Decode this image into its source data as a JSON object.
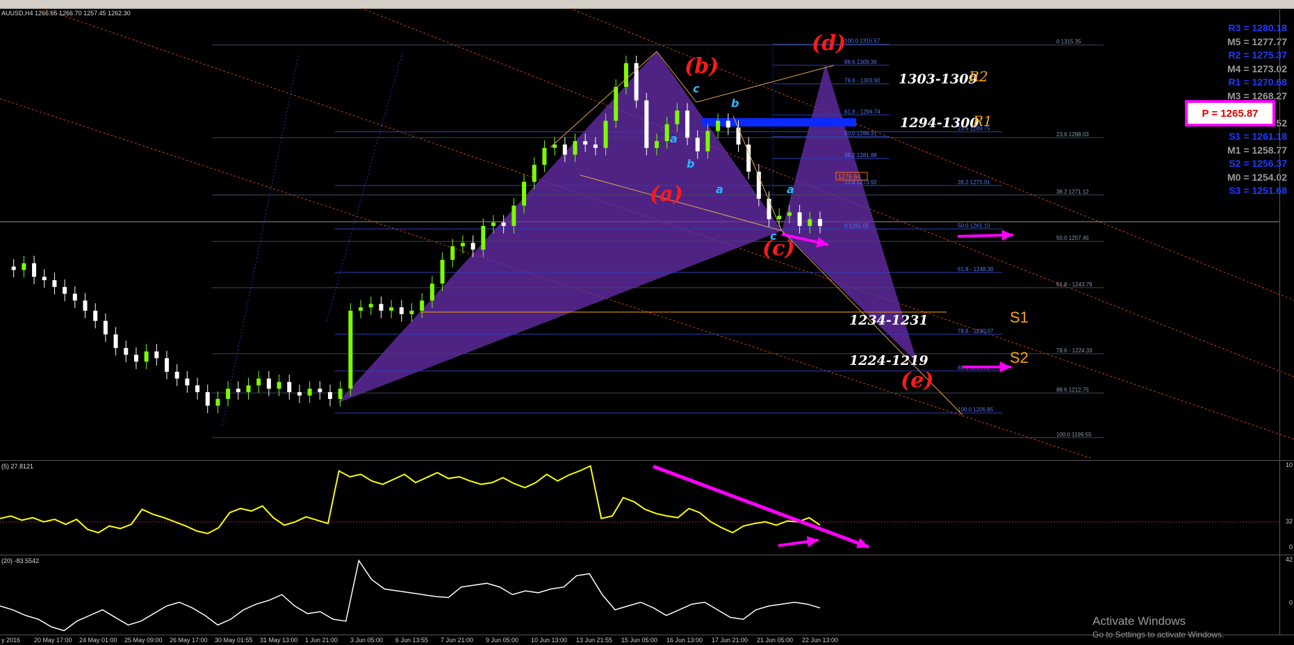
{
  "symbol_info": "AUUSD,H4  1266.65 1266.70 1257.45 1262.30",
  "rsi_info": "(5) 27.8121",
  "cci_info": "(20) -83.5542",
  "chart_data": {
    "type": "candlestick",
    "title": "AUUSD,H4",
    "x_tick_labels": [
      "y 2016",
      "20 May 17:00",
      "24 May 01:00",
      "25 May 09:00",
      "26 May 17:00",
      "30 May 01:55",
      "31 May 13:00",
      "1 Jun 21:00",
      "3 Jun 05:00",
      "6 Jun 13:55",
      "7 Jun 21:00",
      "9 Jun 05:00",
      "10 Jun 13:00",
      "13 Jun 21:55",
      "15 Jun 05:00",
      "16 Jun 13:00",
      "17 Jun 21:00",
      "21 Jun 05:00",
      "22 Jun 13:00"
    ],
    "price_range": [
      1195,
      1320
    ],
    "close_path": [
      1250,
      1249,
      1251,
      1247,
      1246,
      1244,
      1242,
      1240,
      1237,
      1234,
      1230,
      1226,
      1224,
      1222,
      1225,
      1223,
      1219,
      1217,
      1215,
      1213,
      1209,
      1211,
      1214,
      1213,
      1215,
      1217,
      1214,
      1216,
      1213,
      1212,
      1214,
      1213,
      1211,
      1214,
      1237,
      1238,
      1239,
      1237,
      1238,
      1236,
      1237,
      1240,
      1245,
      1252,
      1256,
      1257,
      1255,
      1262,
      1263,
      1262,
      1268,
      1275,
      1280,
      1285,
      1286,
      1283,
      1287,
      1286,
      1285,
      1293,
      1303,
      1310,
      1299,
      1285,
      1287,
      1292,
      1296,
      1288,
      1284,
      1290,
      1293,
      1291,
      1286,
      1278,
      1270,
      1264,
      1265,
      1266,
      1262,
      1264,
      1262
    ],
    "fibonacci_levels_1": [
      {
        "label": "100.0 1315.57",
        "price": 1315.57
      },
      {
        "label": "88.6 1309.36",
        "price": 1309.36
      },
      {
        "label": "78.6 - 1303.90",
        "price": 1303.9
      },
      {
        "label": "61.8 - 1294.74",
        "price": 1294.74
      },
      {
        "label": "50.0 1288.31",
        "price": 1288.31
      },
      {
        "label": "38.2 1281.88",
        "price": 1281.88
      },
      {
        "label": "23.6 1273.92",
        "price": 1273.92
      },
      {
        "label": "0 1261.05",
        "price": 1261.05
      }
    ],
    "fibonacci_levels_2": [
      {
        "label": "0 1315.35",
        "price": 1315.35
      },
      {
        "label": "23.6 1288.03",
        "price": 1288.03
      },
      {
        "label": "38.2 1271.12",
        "price": 1271.12
      },
      {
        "label": "50.0 1257.45",
        "price": 1257.45
      },
      {
        "label": "61.8 - 1243.79",
        "price": 1243.79
      },
      {
        "label": "78.6 - 1224.33",
        "price": 1224.33
      },
      {
        "label": "88.6 1212.75",
        "price": 1212.75
      },
      {
        "label": "100.0 1199.55",
        "price": 1199.55
      }
    ],
    "fibonacci_levels_3": [
      {
        "label": "23.6 1289.75",
        "price": 1289.75
      },
      {
        "label": "38.2 1273.91",
        "price": 1273.91
      },
      {
        "label": "50.0 1261.10",
        "price": 1261.1
      },
      {
        "label": "61.8 - 1248.30",
        "price": 1248.3
      },
      {
        "label": "78.6 - 1230.07",
        "price": 1230.07
      },
      {
        "label": "88.6 1219.22",
        "price": 1219.22
      },
      {
        "label": "100.0 1206.85",
        "price": 1206.85
      }
    ],
    "marked_price": "1276.64",
    "pivot_levels": [
      {
        "label": "R3 = 1280.18",
        "color": "#1e3cff"
      },
      {
        "label": "M5 = 1277.77",
        "color": "#9a9a9a"
      },
      {
        "label": "R2 = 1275.37",
        "color": "#1e3cff"
      },
      {
        "label": "M4 = 1273.02",
        "color": "#9a9a9a"
      },
      {
        "label": "R1 = 1270.68",
        "color": "#1e3cff"
      },
      {
        "label": "M3 = 1268.27",
        "color": "#9a9a9a"
      },
      {
        "label": "P  = 1265.87",
        "color": "#e00000",
        "boxed": true
      },
      {
        "label": "M2 = 1263.52",
        "color": "#9a9a9a"
      },
      {
        "label": "S1 = 1261.18",
        "color": "#1e3cff"
      },
      {
        "label": "M1 = 1258.77",
        "color": "#9a9a9a"
      },
      {
        "label": "S2 = 1256.37",
        "color": "#1e3cff"
      },
      {
        "label": "M0 = 1254.02",
        "color": "#9a9a9a"
      },
      {
        "label": "S3 = 1251.68",
        "color": "#1e3cff"
      }
    ],
    "wave_labels": [
      "(a)",
      "(b)",
      "(c)",
      "(d)",
      "(e)"
    ],
    "sub_wave_labels": [
      "c",
      "a",
      "b",
      "b",
      "a",
      "a",
      "c"
    ],
    "zones": [
      {
        "text": "1303-1309",
        "tag": "R2"
      },
      {
        "text": "1294-1300",
        "tag": "R1"
      },
      {
        "text": "1234-1231",
        "tag": "S1"
      },
      {
        "text": "1224-1219",
        "tag": "S2"
      }
    ],
    "rsi": {
      "period": 5,
      "value": 27.8121,
      "range": [
        0,
        100
      ],
      "tick_labels": [
        "10",
        "32",
        "0"
      ],
      "values": [
        35,
        38,
        33,
        36,
        31,
        34,
        28,
        34,
        22,
        18,
        26,
        23,
        28,
        46,
        40,
        36,
        31,
        26,
        20,
        17,
        24,
        42,
        47,
        44,
        50,
        36,
        27,
        31,
        37,
        33,
        29,
        92,
        85,
        88,
        80,
        76,
        82,
        88,
        78,
        84,
        90,
        83,
        85,
        80,
        76,
        78,
        84,
        77,
        72,
        78,
        88,
        80,
        87,
        92,
        98,
        35,
        38,
        60,
        55,
        46,
        41,
        38,
        36,
        47,
        42,
        31,
        24,
        18,
        26,
        29,
        31,
        27,
        32,
        31,
        36,
        27
      ]
    },
    "cci": {
      "period": 20,
      "value": -83.5542,
      "tick_labels": [
        "42",
        "0"
      ],
      "values": [
        -40,
        -60,
        -90,
        -110,
        -150,
        -170,
        -120,
        -90,
        -60,
        -100,
        -140,
        -120,
        -80,
        -40,
        -20,
        -50,
        -90,
        -140,
        -110,
        -60,
        -30,
        -10,
        20,
        -40,
        -80,
        -70,
        -110,
        -120,
        200,
        100,
        50,
        40,
        30,
        20,
        10,
        5,
        60,
        70,
        80,
        60,
        20,
        40,
        30,
        50,
        60,
        120,
        130,
        20,
        -60,
        -40,
        -20,
        -50,
        -90,
        -60,
        -30,
        -20,
        -60,
        -100,
        -110,
        -60,
        -40,
        -30,
        -20,
        -30,
        -50
      ]
    }
  },
  "annotations": {
    "fib_tag_text": "1276.64"
  },
  "colors": {
    "bull_candle": "#7cfc00",
    "bear_candle": "#ffffff",
    "harmonic_fill": "#6a2fb0",
    "fib_line": "#2233aa",
    "fib_line_gray": "#556",
    "arrow": "#ff00ff",
    "rsi_line": "#ffff00",
    "cci_line": "#ffffff"
  },
  "watermark": {
    "title": "Activate Windows",
    "subtitle": "Go to Settings to activate Windows."
  }
}
